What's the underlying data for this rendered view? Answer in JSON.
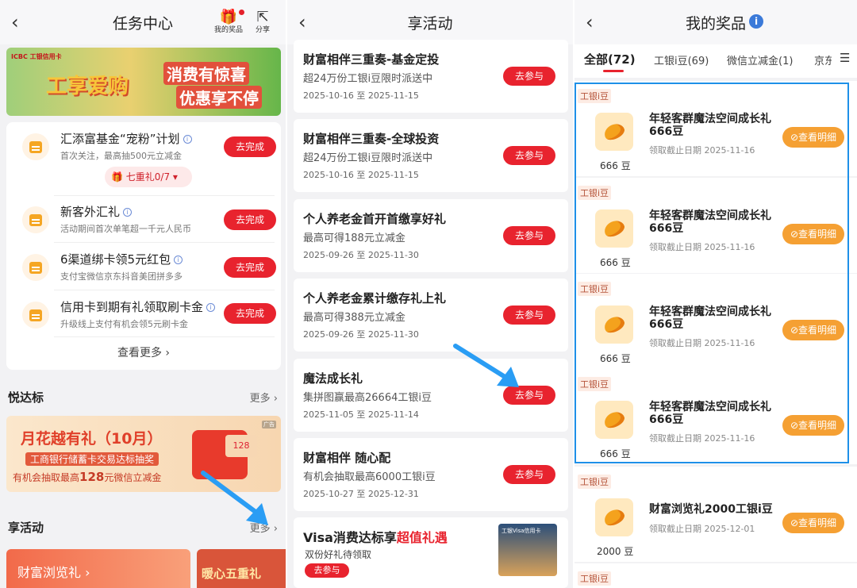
{
  "panel1": {
    "title": "任务中心",
    "my_prizes": "我的奖品",
    "share": "分享",
    "banner": {
      "brand": "ICBC 工银信用卡",
      "slogan_big": "工享爱购",
      "line1": "消费有惊喜",
      "line2": "优惠享不停"
    },
    "tasks": [
      {
        "title": "汇添富基金“宠粉”计划",
        "desc": "首次关注，最高抽500元立减金",
        "btn": "去完成",
        "extra": "七重礼0/7"
      },
      {
        "title": "新客外汇礼",
        "desc": "活动期间首次单笔超一千元人民币",
        "btn": "去完成"
      },
      {
        "title": "6渠道绑卡领5元红包",
        "desc": "支付宝微信京东抖音美团拼多多",
        "btn": "去完成"
      },
      {
        "title": "信用卡到期有礼领取刷卡金",
        "desc": "升级线上支付有机会领5元刷卡金",
        "btn": "去完成"
      }
    ],
    "more": "查看更多",
    "section1": {
      "title": "悦达标",
      "more": "更多"
    },
    "promo": {
      "title": "月花越有礼（10月）",
      "sub": "工商银行储蓄卡交易达标抽奖",
      "desc_pre": "有机会抽取最高",
      "amount": "128",
      "desc_post": "元微信立减金",
      "ad": "广告",
      "coupon": "128"
    },
    "section2": {
      "title": "享活动",
      "more": "更多"
    },
    "bottom": {
      "a": "财富浏览礼",
      "b": "暖心五重礼"
    }
  },
  "panel2": {
    "title": "享活动",
    "activities": [
      {
        "name": "财富相伴三重奏-基金定投",
        "desc": "超24万份工银i豆限时派送中",
        "date": "2025-10-16 至 2025-11-15",
        "btn": "去参与"
      },
      {
        "name": "财富相伴三重奏-全球投资",
        "desc": "超24万份工银i豆限时派送中",
        "date": "2025-10-16 至 2025-11-15",
        "btn": "去参与"
      },
      {
        "name": "个人养老金首开首缴享好礼",
        "desc": "最高可得188元立减金",
        "date": "2025-09-26 至 2025-11-30",
        "btn": "去参与"
      },
      {
        "name": "个人养老金累计缴存礼上礼",
        "desc": "最高可得388元立减金",
        "date": "2025-09-26 至 2025-11-30",
        "btn": "去参与"
      },
      {
        "name": "魔法成长礼",
        "desc": "集拼图赢最高26664工银i豆",
        "date": "2025-11-05 至 2025-11-14",
        "btn": "去参与"
      },
      {
        "name": "财富相伴 随心配",
        "desc": "有机会抽取最高6000工银i豆",
        "date": "2025-10-27 至 2025-12-31",
        "btn": "去参与"
      }
    ],
    "visa": {
      "pre": "Visa消费达标享",
      "hi": "超值礼遇",
      "sub": "双份好礼待领取",
      "btn": "去参与",
      "thumb": "工银Visa信用卡"
    }
  },
  "panel3": {
    "title": "我的奖品",
    "tabs": [
      "全部(72)",
      "工银i豆(69)",
      "微信立减金(1)",
      "京东"
    ],
    "prizes": [
      {
        "tag": "工银i豆",
        "name": "年轻客群魔法空间成长礼666豆",
        "date": "领取截止日期 2025-11-16",
        "count": "666 豆",
        "btn": "查看明细"
      },
      {
        "tag": "工银i豆",
        "name": "年轻客群魔法空间成长礼666豆",
        "date": "领取截止日期 2025-11-16",
        "count": "666 豆",
        "btn": "查看明细"
      },
      {
        "tag": "工银i豆",
        "name": "年轻客群魔法空间成长礼666豆",
        "date": "领取截止日期 2025-11-16",
        "count": "666 豆",
        "btn": "查看明细"
      },
      {
        "tag": "工银i豆",
        "name": "年轻客群魔法空间成长礼666豆",
        "date": "领取截止日期 2025-11-16",
        "count": "666 豆",
        "btn": "查看明细"
      },
      {
        "tag": "工银i豆",
        "name": "财富浏览礼2000工银i豆",
        "date": "领取截止日期 2025-12-01",
        "count": "2000 豆",
        "btn": "查看明细"
      },
      {
        "tag": "工银i豆"
      }
    ]
  },
  "colors": {
    "red": "#e8232e",
    "orange": "#f5a033",
    "blue_arrow": "#2a9df4",
    "highlight": "#1e90e8"
  }
}
